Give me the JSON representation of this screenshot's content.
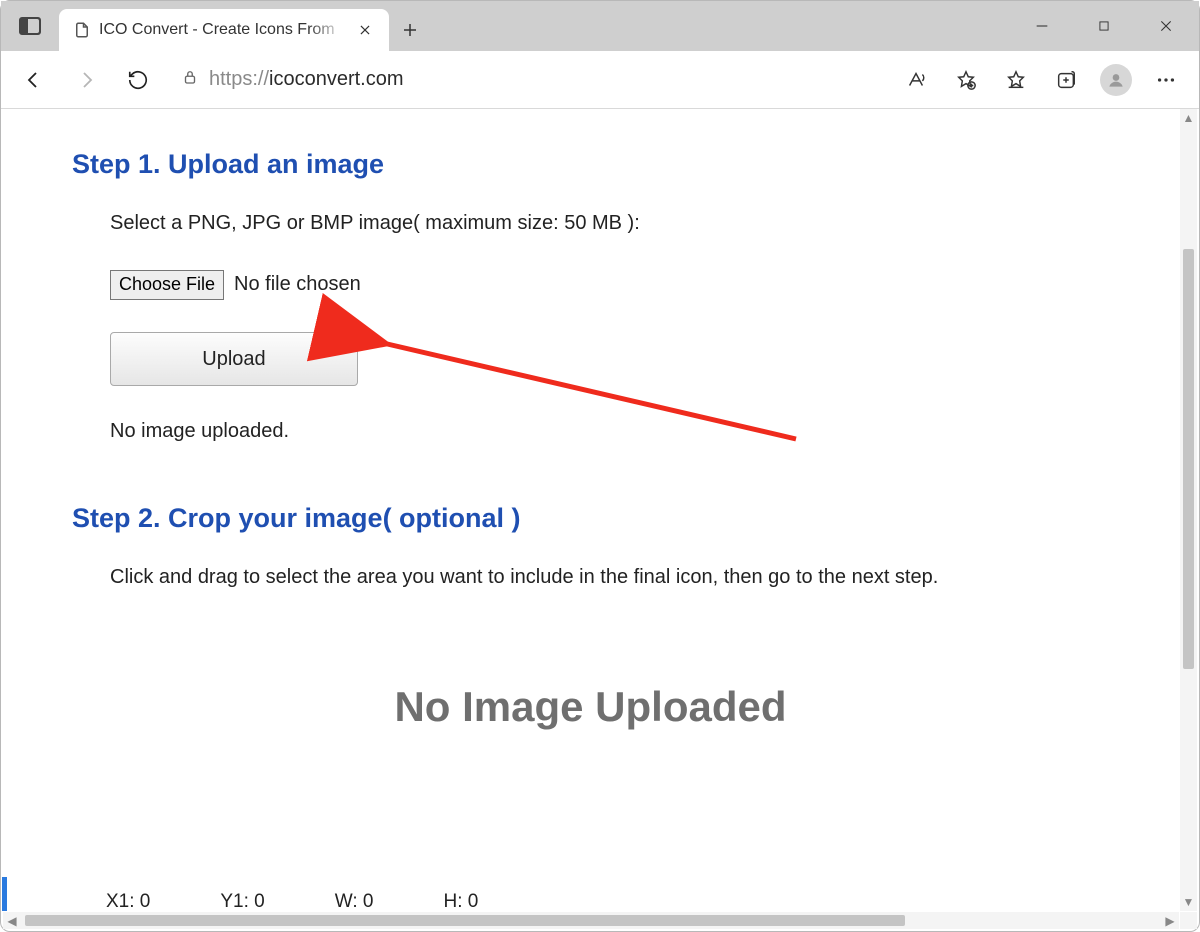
{
  "window": {
    "tab_title": "ICO Convert - Create Icons From"
  },
  "toolbar": {
    "url_scheme": "https://",
    "url_host": "icoconvert.com"
  },
  "page": {
    "step1_title": "Step 1. Upload an image",
    "step1_desc": "Select a PNG, JPG or BMP image( maximum size: 50 MB ):",
    "choose_label": "Choose File",
    "no_file_text": "No file chosen",
    "upload_label": "Upload",
    "status_text": "No image uploaded.",
    "step2_title": "Step 2. Crop your image( optional )",
    "step2_desc": "Click and drag to select the area you want to include in the final icon, then go to the next step.",
    "placeholder": "No Image Uploaded",
    "coords": {
      "x1": "X1: 0",
      "y1": "Y1: 0",
      "w": "W: 0",
      "h": "H: 0"
    }
  }
}
